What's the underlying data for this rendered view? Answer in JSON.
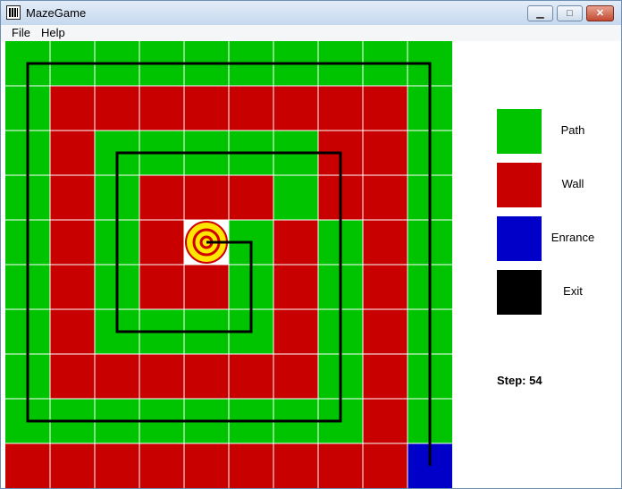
{
  "window": {
    "title": "MazeGame",
    "minimize_label": "▁",
    "maximize_label": "□",
    "close_label": "✕"
  },
  "menu": [
    {
      "label": "File"
    },
    {
      "label": "Help"
    }
  ],
  "colors": {
    "path": "#00c400",
    "wall": "#c80000",
    "entrance": "#0000c8",
    "exit": "#000000",
    "grid": "#ffffff",
    "goal_bg": "#ffffff"
  },
  "maze": {
    "rows": 10,
    "cols": 10,
    "cells": [
      "PPPPPPPPPP",
      "PWWWWWWWWP",
      "PWPPPPPWWP",
      "PWPWWWPWWP",
      "PWPWGPWPWP",
      "PWPWWPWPWP",
      "PWPPPPWPWP",
      "PWWWWWWPWP",
      "PPPPPPPPWP",
      "WWWWWWWWWE"
    ]
  },
  "solution_path": [
    [
      9.5,
      9.5
    ],
    [
      9.5,
      0.5
    ],
    [
      0.5,
      0.5
    ],
    [
      0.5,
      8.5
    ],
    [
      7.5,
      8.5
    ],
    [
      7.5,
      2.5
    ],
    [
      2.5,
      2.5
    ],
    [
      2.5,
      6.5
    ],
    [
      5.5,
      6.5
    ],
    [
      5.5,
      4.5
    ],
    [
      4.5,
      4.5
    ]
  ],
  "legend": [
    {
      "label": "Path",
      "color": "#00c400"
    },
    {
      "label": "Wall",
      "color": "#c80000"
    },
    {
      "label": "Enrance",
      "color": "#0000c8"
    },
    {
      "label": "Exit",
      "color": "#000000"
    }
  ],
  "step": {
    "text": "Step: 54"
  }
}
